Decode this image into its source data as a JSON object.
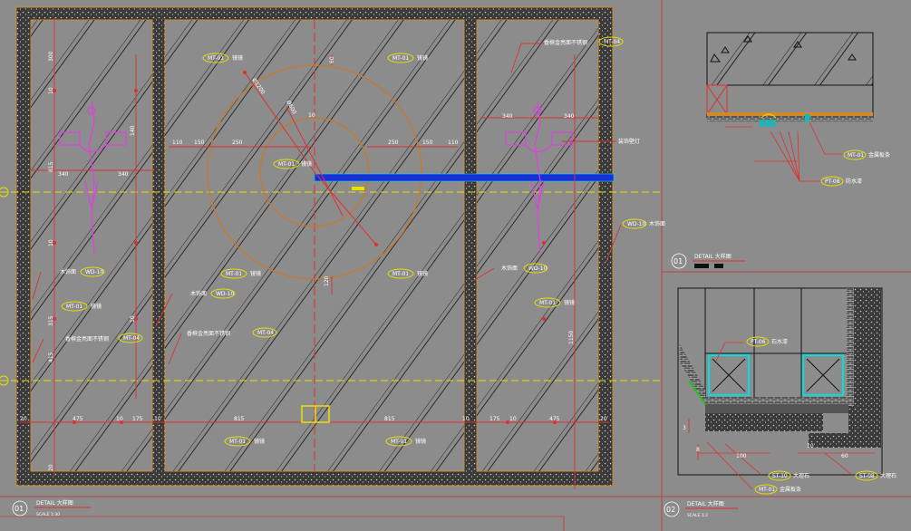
{
  "elevation": {
    "mt01_glass": "镜镜",
    "mt04_stainless": "香槟金亮面不锈钢",
    "wd10_wood": "木饰面",
    "wall_lamp": "装饰壁灯",
    "tag_mt01": "MT-01",
    "tag_mt04": "MT-04",
    "tag_wd10": "WD-10",
    "dims_horizontal": [
      "20",
      "475",
      "10",
      "175",
      "10",
      "815",
      "815",
      "10",
      "175",
      "10",
      "475",
      "20"
    ],
    "dims_left_vertical": [
      "300",
      "10",
      "140",
      "815",
      "10",
      "315",
      "10",
      "415",
      "20"
    ],
    "dims_top": [
      "110",
      "150",
      "250",
      "250",
      "150",
      "110",
      "340",
      "340",
      "340",
      "340"
    ],
    "dims_right_vertical": [
      "1150"
    ],
    "dims_circle": [
      "Ø1200",
      "Ø600",
      "10",
      "60",
      "120"
    ],
    "footer_number": "01",
    "footer_title": "DETAIL 大样图",
    "footer_scale": "SCALE  1:30"
  },
  "detail1": {
    "label_mt01": "MT-01",
    "text_mt01": "金属板条",
    "label_pt08": "PT-08",
    "text_pt08": "防水漆",
    "footer_number": "01",
    "footer_title": "DETAIL 大样图"
  },
  "detail2": {
    "label_pt06": "PT-06",
    "text_pt06": "石水漆",
    "label_st10": "ST-10",
    "text_st10": "大理石",
    "label_st08": "ST-08",
    "text_st08": "大理石",
    "label_mt01": "MT-01",
    "text_mt01": "金属板条",
    "dims": [
      "3",
      "8",
      "100",
      "10",
      "60"
    ],
    "footer_number": "02",
    "footer_title": "DETAIL 大样图",
    "footer_scale": "SCALE  1:2"
  }
}
